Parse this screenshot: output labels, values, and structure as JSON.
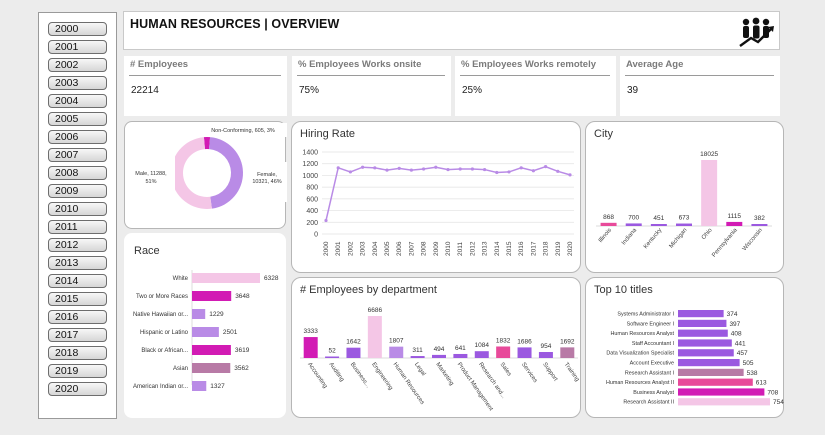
{
  "header": {
    "title": "HUMAN RESOURCES | OVERVIEW",
    "logo_icon": "team-growth-icon"
  },
  "years": [
    "2000",
    "2001",
    "2002",
    "2003",
    "2004",
    "2005",
    "2006",
    "2007",
    "2008",
    "2009",
    "2010",
    "2011",
    "2012",
    "2013",
    "2014",
    "2015",
    "2016",
    "2017",
    "2018",
    "2019",
    "2020"
  ],
  "kpis": [
    {
      "label": "# Employees",
      "value": "22214"
    },
    {
      "label": "% Employees Works onsite",
      "value": "75%"
    },
    {
      "label": "% Employees Works remotely",
      "value": "25%"
    },
    {
      "label": "Average Age",
      "value": "39"
    }
  ],
  "colors": {
    "magenta": "#d21bb4",
    "pink": "#e84a9a",
    "light_pink": "#f4c6e6",
    "purple": "#9b59e0",
    "lavender": "#b98be6",
    "mauve": "#b87aa6"
  },
  "chart_data": [
    {
      "type": "pie",
      "donut": true,
      "categories": [
        "Non-Conforming",
        "Female",
        "Male"
      ],
      "values": [
        605,
        10321,
        11288
      ],
      "labels": [
        "Non-Conforming, 605, 3%",
        "Female, 10321, 46%",
        "Male, 11288, 51%"
      ],
      "colors": [
        "#d21bb4",
        "#b98be6",
        "#f4c6e6"
      ]
    },
    {
      "type": "bar",
      "orientation": "horizontal",
      "title": "Race",
      "categories": [
        "White",
        "Two or More Races",
        "Native Hawaiian or...",
        "Hispanic or Latino",
        "Black or African...",
        "Asian",
        "American Indian or..."
      ],
      "values": [
        6328,
        3648,
        1229,
        2501,
        3619,
        3562,
        1327
      ],
      "colors": [
        "#f4c6e6",
        "#d21bb4",
        "#b98be6",
        "#b98be6",
        "#d21bb4",
        "#b87aa6",
        "#b98be6"
      ]
    },
    {
      "type": "line",
      "title": "Hiring Rate",
      "x": [
        "2000",
        "2001",
        "2002",
        "2003",
        "2004",
        "2005",
        "2006",
        "2007",
        "2008",
        "2009",
        "2010",
        "2011",
        "2012",
        "2013",
        "2014",
        "2015",
        "2016",
        "2017",
        "2018",
        "2019",
        "2020"
      ],
      "values": [
        230,
        1130,
        1060,
        1140,
        1130,
        1090,
        1120,
        1090,
        1110,
        1140,
        1100,
        1110,
        1110,
        1100,
        1050,
        1060,
        1130,
        1080,
        1150,
        1070,
        1010
      ],
      "ylim": [
        0,
        1400
      ],
      "yticks": [
        "0",
        "200",
        "400",
        "600",
        "800",
        "1000",
        "1200",
        "1400"
      ],
      "color": "#b98be6"
    },
    {
      "type": "bar",
      "title": "City",
      "categories": [
        "Illinois",
        "Indiana",
        "Kentucky",
        "Michigan",
        "Ohio",
        "Pennsylvania",
        "Wisconsin"
      ],
      "values": [
        868,
        700,
        451,
        673,
        18025,
        1115,
        382
      ],
      "value_labels": [
        "868",
        "700",
        "451",
        "673",
        "18025",
        "1115",
        "382"
      ],
      "colors": [
        "#e84a9a",
        "#9b59e0",
        "#9b59e0",
        "#9b59e0",
        "#f4c6e6",
        "#d21bb4",
        "#9b59e0"
      ]
    },
    {
      "type": "bar",
      "title": "# Employees by department",
      "categories": [
        "Accounting",
        "Auditing",
        "Business...",
        "Engineering",
        "Human Resources",
        "Legal",
        "Marketing",
        "Product Management",
        "Research and...",
        "Sales",
        "Services",
        "Support",
        "Training"
      ],
      "values": [
        3333,
        52,
        1642,
        6686,
        1807,
        311,
        494,
        641,
        1084,
        1832,
        1686,
        954,
        1692
      ],
      "colors": [
        "#d21bb4",
        "#9b59e0",
        "#9b59e0",
        "#f4c6e6",
        "#b98be6",
        "#9b59e0",
        "#9b59e0",
        "#9b59e0",
        "#9b59e0",
        "#e84a9a",
        "#9b59e0",
        "#9b59e0",
        "#b87aa6"
      ]
    },
    {
      "type": "bar",
      "orientation": "horizontal",
      "title": "Top 10 titles",
      "categories": [
        "Systems Administrator I",
        "Software Engineer I",
        "Human Resources Analyst",
        "Staff Accountant I",
        "Data Visualization Specialist",
        "Account Executive",
        "Research Assistant I",
        "Human Resources Analyst II",
        "Business Analyst",
        "Research Assistant II"
      ],
      "values": [
        374,
        397,
        408,
        441,
        457,
        505,
        538,
        613,
        708,
        754
      ],
      "colors": [
        "#9b59e0",
        "#9b59e0",
        "#9b59e0",
        "#9b59e0",
        "#9b59e0",
        "#9b59e0",
        "#b87aa6",
        "#e84a9a",
        "#d21bb4",
        "#f4c6e6"
      ]
    }
  ]
}
